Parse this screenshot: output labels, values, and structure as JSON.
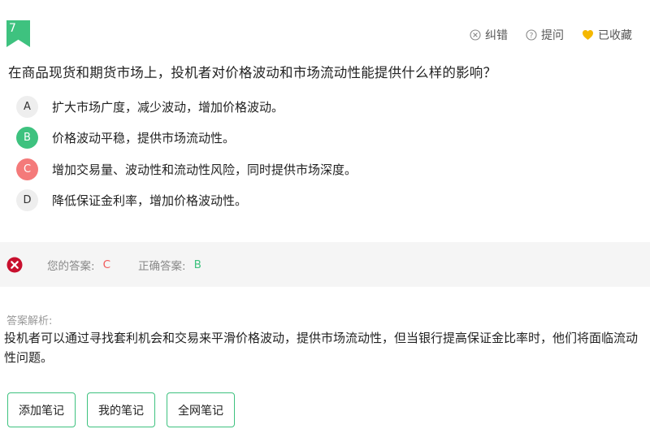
{
  "question": {
    "number": "7",
    "text": "在商品现货和期货市场上，投机者对价格波动和市场流动性能提供什么样的影响？",
    "options": [
      {
        "letter": "A",
        "text": "扩大市场广度，减少波动，增加价格波动。",
        "state": "normal"
      },
      {
        "letter": "B",
        "text": "价格波动平稳，提供市场流动性。",
        "state": "correct"
      },
      {
        "letter": "C",
        "text": "增加交易量、波动性和流动性风险，同时提供市场深度。",
        "state": "wrong"
      },
      {
        "letter": "D",
        "text": "降低保证金利率，增加价格波动性。",
        "state": "normal"
      }
    ]
  },
  "actions": {
    "report_error": "纠错",
    "ask": "提问",
    "collected": "已收藏"
  },
  "result": {
    "your_answer_label": "您的答案:",
    "your_answer": "C",
    "correct_answer_label": "正确答案:",
    "correct_answer": "B"
  },
  "analysis": {
    "title": "答案解析:",
    "text": "投机者可以通过寻找套利机会和交易来平滑价格波动，提供市场流动性，但当银行提高保证金比率时，他们将面临流动性问题。"
  },
  "notes": {
    "add": "添加笔记",
    "mine": "我的笔记",
    "all": "全网笔记"
  },
  "colors": {
    "accent": "#3ec27f",
    "wrong": "#f47a7a",
    "error_icon": "#c8102e",
    "collect_heart": "#f5b800"
  }
}
